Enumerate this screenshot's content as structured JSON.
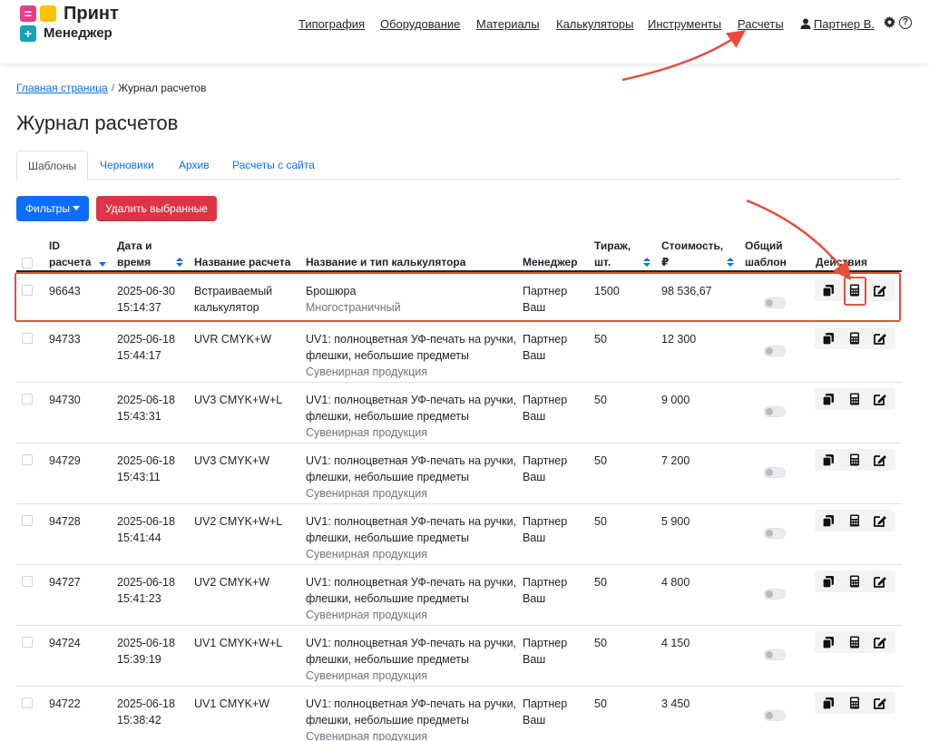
{
  "app": {
    "logo_line1": "Принт",
    "logo_line2": "Менеджер",
    "logo_plus": "+"
  },
  "nav": {
    "items": [
      "Типография",
      "Оборудование",
      "Материалы",
      "Калькуляторы",
      "Инструменты",
      "Расчеты"
    ],
    "user": "Партнер В.",
    "help": "?"
  },
  "breadcrumb": {
    "home": "Главная страница",
    "sep": "/",
    "current": "Журнал расчетов"
  },
  "page_title": "Журнал расчетов",
  "tabs": [
    "Шаблоны",
    "Черновики",
    "Архив",
    "Расчеты с сайта"
  ],
  "buttons": {
    "filters": "Фильтры",
    "delete_selected": "Удалить выбранные"
  },
  "table": {
    "headers": {
      "id_1": "ID",
      "id_2": "расчета",
      "date_1": "Дата и",
      "date_2": "время",
      "name": "Название расчета",
      "calc": "Название и тип калькулятора",
      "manager": "Менеджер",
      "qty_1": "Тираж,",
      "qty_2": "шт.",
      "cost_1": "Стоимость,",
      "cost_2": "₽",
      "shared_1": "Общий",
      "shared_2": "шаблон",
      "actions": "Действия"
    },
    "rows": [
      {
        "id": "96643",
        "date": "2025-06-30",
        "time": "15:14:37",
        "name1": "Встраиваемый",
        "name2": "калькулятор",
        "calc1": "Брошюра",
        "calc2": "",
        "type": "Многостраничный",
        "mgr1": "Партнер",
        "mgr2": "Ваш",
        "qty": "1500",
        "cost": "98 536,67"
      },
      {
        "id": "94733",
        "date": "2025-06-18",
        "time": "15:44:17",
        "name1": "UVR CMYK+W",
        "name2": "",
        "calc1": "UV1: полноцветная УФ-печать на ручки,",
        "calc2": "флешки, небольшие предметы",
        "type": "Сувенирная продукция",
        "mgr1": "Партнер",
        "mgr2": "Ваш",
        "qty": "50",
        "cost": "12 300"
      },
      {
        "id": "94730",
        "date": "2025-06-18",
        "time": "15:43:31",
        "name1": "UV3 CMYK+W+L",
        "name2": "",
        "calc1": "UV1: полноцветная УФ-печать на ручки,",
        "calc2": "флешки, небольшие предметы",
        "type": "Сувенирная продукция",
        "mgr1": "Партнер",
        "mgr2": "Ваш",
        "qty": "50",
        "cost": "9 000"
      },
      {
        "id": "94729",
        "date": "2025-06-18",
        "time": "15:43:11",
        "name1": "UV3 CMYK+W",
        "name2": "",
        "calc1": "UV1: полноцветная УФ-печать на ручки,",
        "calc2": "флешки, небольшие предметы",
        "type": "Сувенирная продукция",
        "mgr1": "Партнер",
        "mgr2": "Ваш",
        "qty": "50",
        "cost": "7 200"
      },
      {
        "id": "94728",
        "date": "2025-06-18",
        "time": "15:41:44",
        "name1": "UV2 CMYK+W+L",
        "name2": "",
        "calc1": "UV1: полноцветная УФ-печать на ручки,",
        "calc2": "флешки, небольшие предметы",
        "type": "Сувенирная продукция",
        "mgr1": "Партнер",
        "mgr2": "Ваш",
        "qty": "50",
        "cost": "5 900"
      },
      {
        "id": "94727",
        "date": "2025-06-18",
        "time": "15:41:23",
        "name1": "UV2 CMYK+W",
        "name2": "",
        "calc1": "UV1: полноцветная УФ-печать на ручки,",
        "calc2": "флешки, небольшие предметы",
        "type": "Сувенирная продукция",
        "mgr1": "Партнер",
        "mgr2": "Ваш",
        "qty": "50",
        "cost": "4 800"
      },
      {
        "id": "94724",
        "date": "2025-06-18",
        "time": "15:39:19",
        "name1": "UV1 CMYK+W+L",
        "name2": "",
        "calc1": "UV1: полноцветная УФ-печать на ручки,",
        "calc2": "флешки, небольшие предметы",
        "type": "Сувенирная продукция",
        "mgr1": "Партнер",
        "mgr2": "Ваш",
        "qty": "50",
        "cost": "4 150"
      },
      {
        "id": "94722",
        "date": "2025-06-18",
        "time": "15:38:42",
        "name1": "UV1 CMYK+W",
        "name2": "",
        "calc1": "UV1: полноцветная УФ-печать на ручки,",
        "calc2": "флешки, небольшие предметы",
        "type": "Сувенирная продукция",
        "mgr1": "Партнер",
        "mgr2": "Ваш",
        "qty": "50",
        "cost": "3 450"
      }
    ]
  },
  "icons": {
    "copy": "copy-icon",
    "calculator": "calculator-icon",
    "edit": "edit-icon",
    "user": "user-icon",
    "settings": "gear-icon",
    "help": "help-icon"
  },
  "colors": {
    "primary": "#0d6efd",
    "danger": "#dc3545",
    "annotation": "#e74c3c",
    "logo_pink": "#e83e8c",
    "logo_yellow": "#ffc107",
    "logo_cyan": "#17a2b8"
  }
}
